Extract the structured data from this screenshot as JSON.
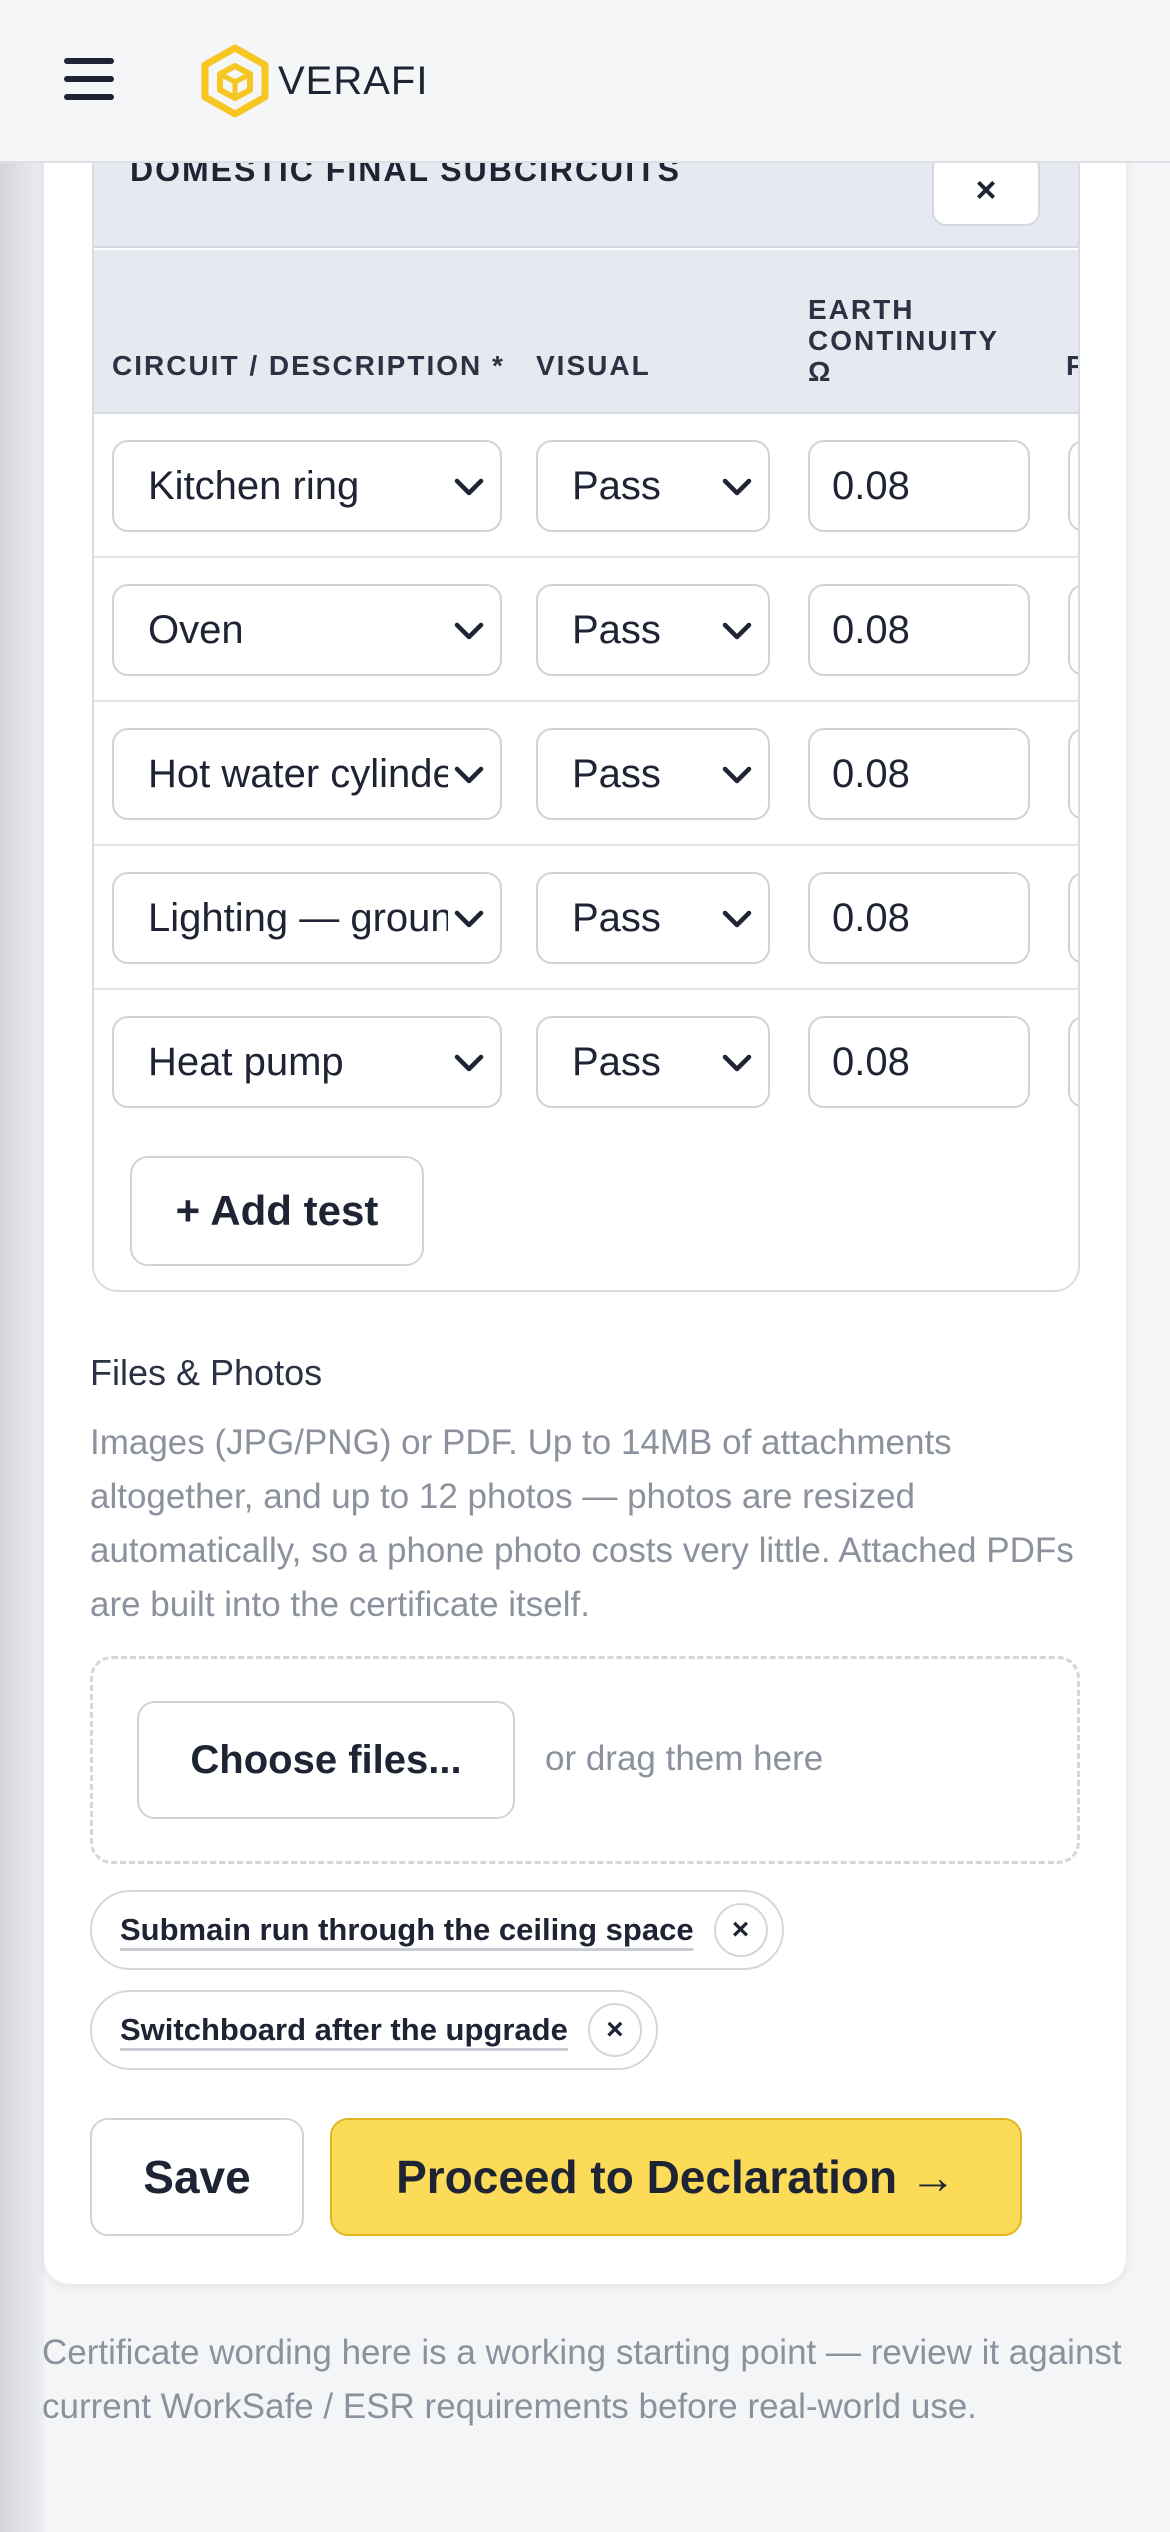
{
  "app": {
    "brand": "VERAFI"
  },
  "section": {
    "title": "DOMESTIC FINAL SUBCIRCUITS",
    "close_glyph": "×"
  },
  "table": {
    "columns": [
      "CIRCUIT / DESCRIPTION *",
      "VISUAL",
      "EARTH CONTINUITY Ω",
      "P"
    ],
    "rows": [
      {
        "circuit": "Kitchen ring",
        "visual": "Pass",
        "earth": "0.08"
      },
      {
        "circuit": "Oven",
        "visual": "Pass",
        "earth": "0.08"
      },
      {
        "circuit": "Hot water cylinder",
        "visual": "Pass",
        "earth": "0.08"
      },
      {
        "circuit": "Lighting — ground",
        "visual": "Pass",
        "earth": "0.08"
      },
      {
        "circuit": "Heat pump",
        "visual": "Pass",
        "earth": "0.08"
      }
    ],
    "add_label": "+ Add test"
  },
  "files": {
    "label": "Files & Photos",
    "help": "Images (JPG/PNG) or PDF. Up to 14MB of attachments altogether, and up to 12 photos — photos are resized automatically, so a phone photo costs very little. Attached PDFs are built into the certificate itself.",
    "choose_label": "Choose files...",
    "drag_text": "or drag them here",
    "attachments": [
      {
        "name": "Submain run through the ceiling space",
        "remove": "×"
      },
      {
        "name": "Switchboard after the upgrade",
        "remove": "×"
      }
    ]
  },
  "actions": {
    "save": "Save",
    "proceed": "Proceed to Declaration →"
  },
  "footer": {
    "note": "Certificate wording here is a working starting point — review it against current WorkSafe / ESR requirements before real-world use."
  },
  "colors": {
    "accent": "#fbdb57",
    "logo": "#f6c623",
    "text": "#1e2433",
    "muted": "#8c929d"
  }
}
